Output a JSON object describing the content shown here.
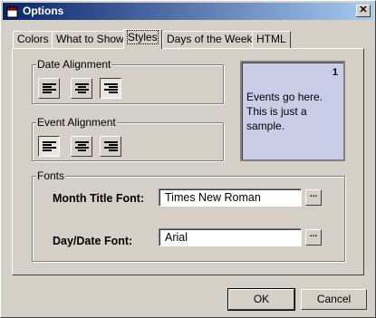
{
  "window": {
    "title": "Options",
    "close_glyph": "✕"
  },
  "tabs": [
    {
      "label": "Colors",
      "active": false
    },
    {
      "label": "What to Show",
      "active": false
    },
    {
      "label": "Styles",
      "active": true
    },
    {
      "label": "Days of the Week",
      "active": false
    },
    {
      "label": "HTML",
      "active": false
    }
  ],
  "date_alignment": {
    "label": "Date Alignment",
    "buttons": [
      {
        "icon": "align-left-icon",
        "pressed": false
      },
      {
        "icon": "align-center-icon",
        "pressed": false
      },
      {
        "icon": "align-right-icon",
        "pressed": true
      }
    ]
  },
  "event_alignment": {
    "label": "Event Alignment",
    "buttons": [
      {
        "icon": "align-left-icon",
        "pressed": true
      },
      {
        "icon": "align-center-icon",
        "pressed": false
      },
      {
        "icon": "align-right-icon",
        "pressed": false
      }
    ]
  },
  "sample": {
    "day_number": "1",
    "text": "Events go here. This is just a sample.",
    "background": "#c9cde8"
  },
  "fonts": {
    "label": "Fonts",
    "month_title_label": "Month Title Font:",
    "month_title_value": "Times New Roman",
    "day_date_label": "Day/Date Font:",
    "day_date_value": "Arial",
    "browse_label": "..."
  },
  "buttons": {
    "ok": "OK",
    "cancel": "Cancel"
  },
  "colors": {
    "titlebar_start": "#0a246a",
    "titlebar_end": "#a6caf0",
    "face": "#d4d0c8"
  }
}
